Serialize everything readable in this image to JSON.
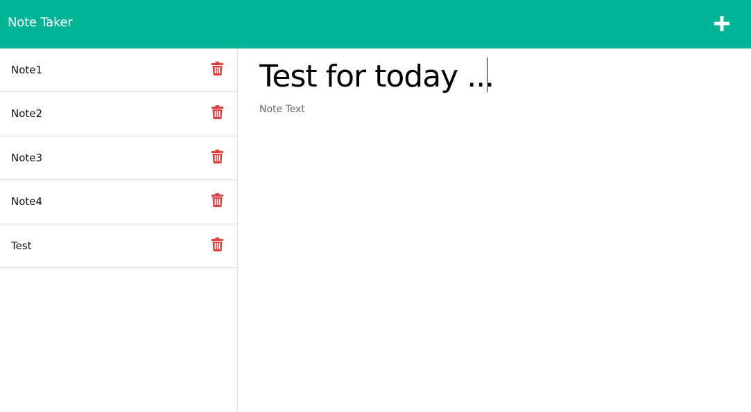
{
  "app": {
    "brand": "Note Taker",
    "accent_color": "#00b596",
    "delete_color": "#e63b3b"
  },
  "header": {
    "add_icon": "plus-icon"
  },
  "sidebar": {
    "items": [
      {
        "label": "Note1",
        "icon": "trash-icon"
      },
      {
        "label": "Note2",
        "icon": "trash-icon"
      },
      {
        "label": "Note3",
        "icon": "trash-icon"
      },
      {
        "label": "Note4",
        "icon": "trash-icon"
      },
      {
        "label": "Test",
        "icon": "trash-icon"
      }
    ]
  },
  "editor": {
    "title_value": "Test for today ...",
    "text_value": "",
    "text_placeholder": "Note Text"
  }
}
